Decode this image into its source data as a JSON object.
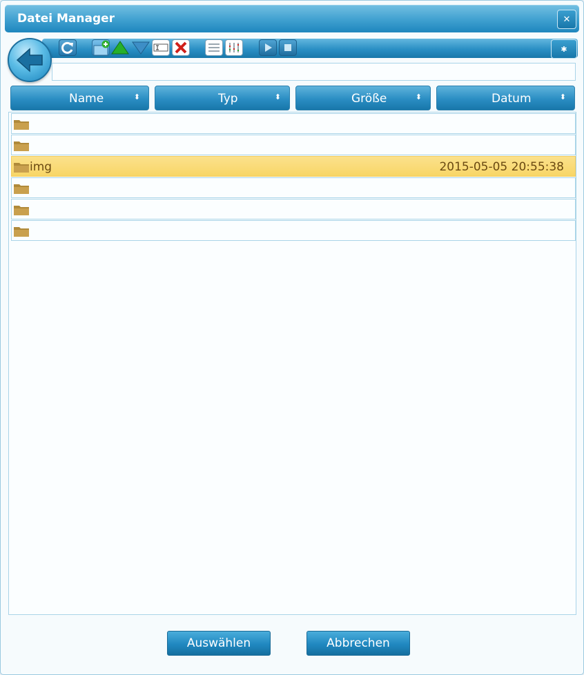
{
  "window": {
    "title": "Datei Manager"
  },
  "toolbar": {
    "icons": [
      "refresh-icon",
      "new-folder-icon",
      "upload-icon",
      "download-icon",
      "rename-icon",
      "delete-icon",
      "list-view-icon",
      "details-view-icon",
      "play-icon",
      "stop-icon"
    ]
  },
  "path": {
    "value": ""
  },
  "columns": [
    {
      "label": "Name"
    },
    {
      "label": "Typ"
    },
    {
      "label": "Größe"
    },
    {
      "label": "Datum"
    }
  ],
  "rows": [
    {
      "name": "",
      "date": "",
      "selected": false
    },
    {
      "name": "",
      "date": "",
      "selected": false
    },
    {
      "name": "img",
      "date": "2015-05-05 20:55:38",
      "selected": true
    },
    {
      "name": "",
      "date": "",
      "selected": false
    },
    {
      "name": "",
      "date": "",
      "selected": false
    },
    {
      "name": "",
      "date": "",
      "selected": false
    }
  ],
  "buttons": {
    "select_label": "Auswählen",
    "cancel_label": "Abbrechen",
    "close_glyph": "✕",
    "settings_glyph": "✱"
  },
  "colors": {
    "accent": "#2a8dc3",
    "selection": "#f8d666",
    "folder": "#b08a3a"
  }
}
